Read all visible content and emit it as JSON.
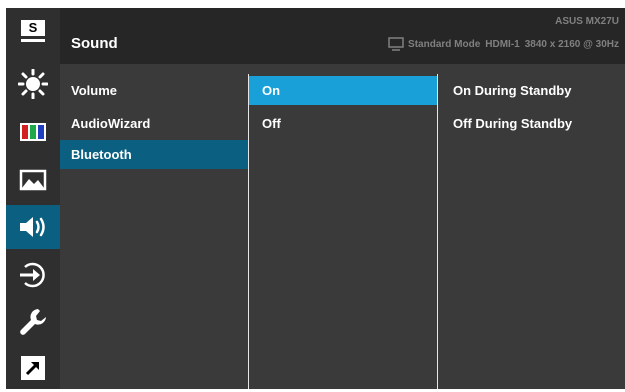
{
  "sidebar": {
    "items": [
      {
        "icon": "splendid-s-icon",
        "label": "S",
        "active": false
      },
      {
        "icon": "brightness-icon",
        "active": false
      },
      {
        "icon": "color-bars-icon",
        "active": false
      },
      {
        "icon": "image-icon",
        "active": false
      },
      {
        "icon": "speaker-sound-icon",
        "active": true
      },
      {
        "icon": "input-select-icon",
        "active": false
      },
      {
        "icon": "wrench-icon",
        "active": false
      },
      {
        "icon": "shortcut-arrow-icon",
        "active": false
      }
    ]
  },
  "header": {
    "title": "Sound",
    "model": "ASUS MX27U",
    "mode": "Standard Mode",
    "input": "HDMI-1",
    "resolution": "3840 x 2160 @ 30Hz"
  },
  "menu": {
    "col1": [
      "Volume",
      "AudioWizard",
      "Bluetooth"
    ],
    "col2": [
      "On",
      "Off"
    ],
    "col3": [
      "On During Standby",
      "Off During Standby"
    ]
  },
  "colors": {
    "active_dark": "#0b5f80",
    "highlight": "#1aa0d8",
    "panel": "#3a3a3a",
    "header": "#262626"
  }
}
